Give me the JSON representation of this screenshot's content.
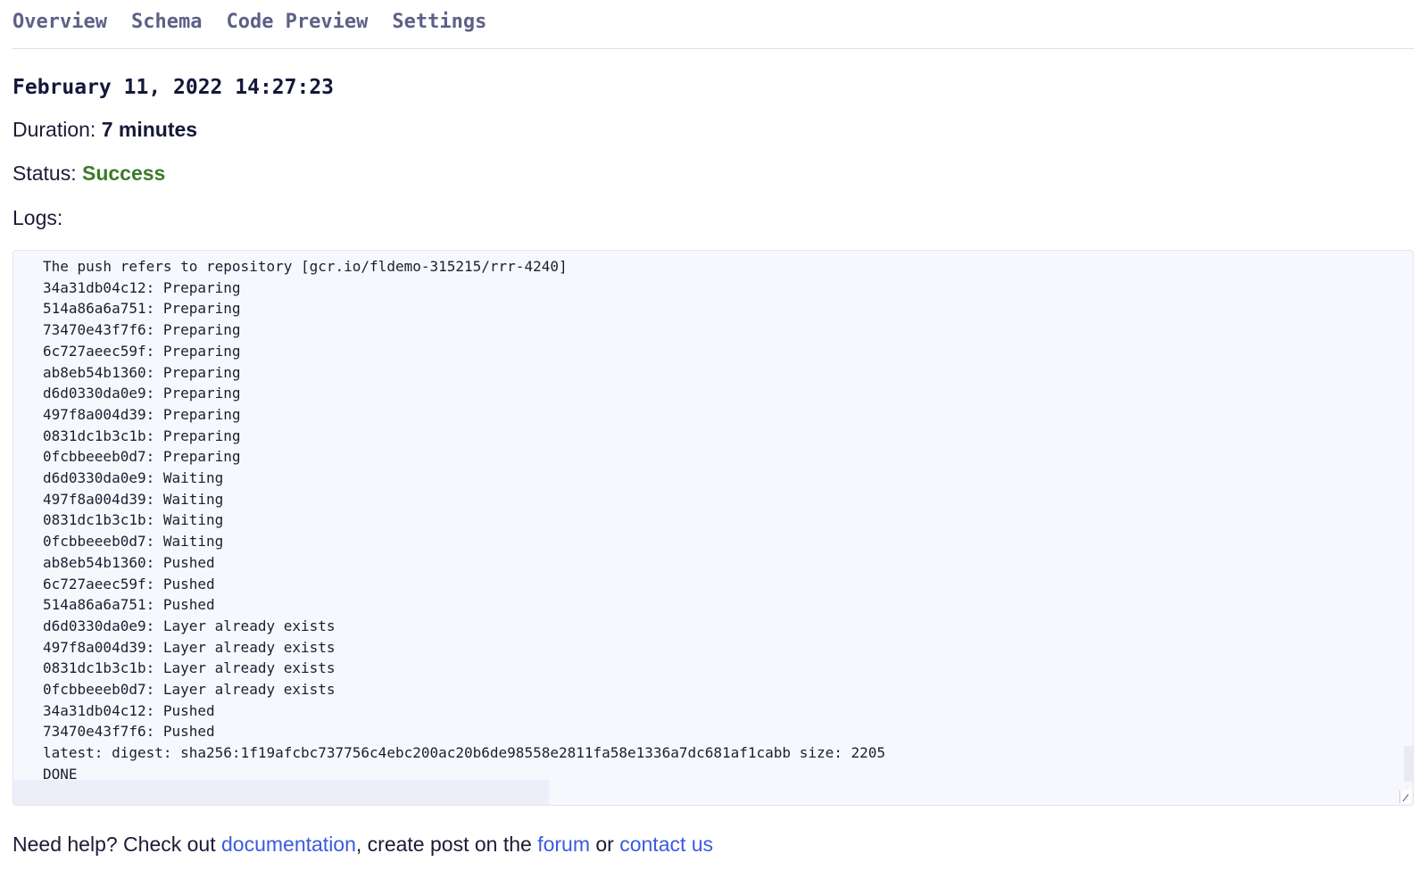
{
  "tabs": [
    "Overview",
    "Schema",
    "Code Preview",
    "Settings"
  ],
  "build": {
    "date": "February 11, 2022 14:27:23",
    "duration_label": "Duration:",
    "duration_value": "7 minutes",
    "status_label": "Status:",
    "status_value": "Success",
    "logs_label": "Logs:"
  },
  "logs": [
    "The push refers to repository [gcr.io/fldemo-315215/rrr-4240]",
    "34a31db04c12: Preparing",
    "514a86a6a751: Preparing",
    "73470e43f7f6: Preparing",
    "6c727aeec59f: Preparing",
    "ab8eb54b1360: Preparing",
    "d6d0330da0e9: Preparing",
    "497f8a004d39: Preparing",
    "0831dc1b3c1b: Preparing",
    "0fcbbeeeb0d7: Preparing",
    "d6d0330da0e9: Waiting",
    "497f8a004d39: Waiting",
    "0831dc1b3c1b: Waiting",
    "0fcbbeeeb0d7: Waiting",
    "ab8eb54b1360: Pushed",
    "6c727aeec59f: Pushed",
    "514a86a6a751: Pushed",
    "d6d0330da0e9: Layer already exists",
    "497f8a004d39: Layer already exists",
    "0831dc1b3c1b: Layer already exists",
    "0fcbbeeeb0d7: Layer already exists",
    "34a31db04c12: Pushed",
    "73470e43f7f6: Pushed",
    "latest: digest: sha256:1f19afcbc737756c4ebc200ac20b6de98558e2811fa58e1336a7dc681af1cabb size: 2205",
    "DONE"
  ],
  "help": {
    "prefix": "Need help? Check out ",
    "documentation_link": "documentation",
    "middle": ", create post on the ",
    "forum_link": "forum",
    "or_text": " or ",
    "contact_link": "contact us"
  }
}
